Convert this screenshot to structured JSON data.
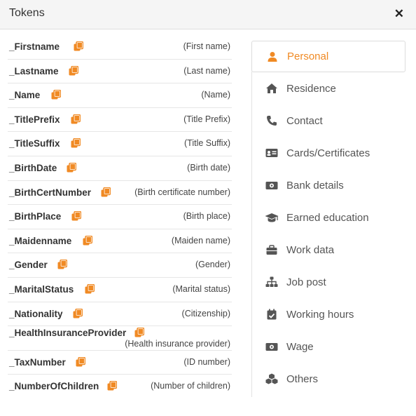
{
  "dialog": {
    "title": "Tokens",
    "close_icon": "close-icon"
  },
  "tokens": [
    {
      "token": "_Firstname",
      "desc": "(First name)"
    },
    {
      "token": "_Lastname",
      "desc": "(Last name)"
    },
    {
      "token": "_Name",
      "desc": "(Name)"
    },
    {
      "token": "_TitlePrefix",
      "desc": "(Title Prefix)"
    },
    {
      "token": "_TitleSuffix",
      "desc": "(Title Suffix)"
    },
    {
      "token": "_BirthDate",
      "desc": "(Birth date)"
    },
    {
      "token": "_BirthCertNumber",
      "desc": "(Birth certificate number)"
    },
    {
      "token": "_BirthPlace",
      "desc": "(Birth place)"
    },
    {
      "token": "_Maidenname",
      "desc": "(Maiden name)"
    },
    {
      "token": "_Gender",
      "desc": "(Gender)"
    },
    {
      "token": "_MaritalStatus",
      "desc": "(Marital status)"
    },
    {
      "token": "_Nationality",
      "desc": "(Citizenship)"
    },
    {
      "token": "_HealthInsuranceProvider",
      "desc": "(Health insurance provider)"
    },
    {
      "token": "_TaxNumber",
      "desc": "(ID number)"
    },
    {
      "token": "_NumberOfChildren",
      "desc": "(Number of children)"
    }
  ],
  "copy_icon": "copy-icon",
  "categories": [
    {
      "label": "Personal",
      "icon": "person-icon",
      "active": true
    },
    {
      "label": "Residence",
      "icon": "home-icon"
    },
    {
      "label": "Contact",
      "icon": "phone-icon"
    },
    {
      "label": "Cards/Certificates",
      "icon": "id-card-icon"
    },
    {
      "label": "Bank details",
      "icon": "money-icon"
    },
    {
      "label": "Earned education",
      "icon": "graduation-cap-icon"
    },
    {
      "label": "Work data",
      "icon": "briefcase-icon"
    },
    {
      "label": "Job post",
      "icon": "sitemap-icon"
    },
    {
      "label": "Working hours",
      "icon": "calendar-check-icon"
    },
    {
      "label": "Wage",
      "icon": "money-icon"
    },
    {
      "label": "Others",
      "icon": "cubes-icon"
    }
  ],
  "colors": {
    "accent": "#f08a24",
    "icon_gray": "#555555",
    "header_bg": "#f5f5f5"
  }
}
